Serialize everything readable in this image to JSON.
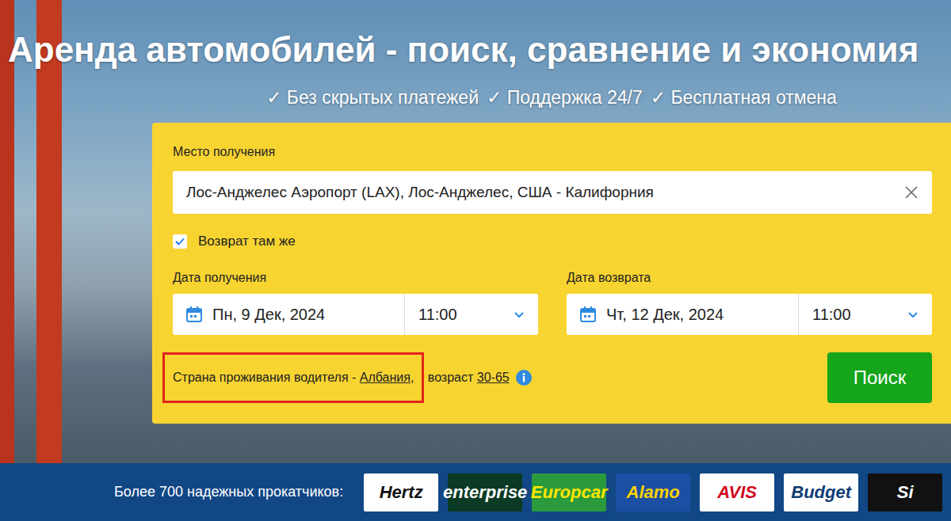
{
  "hero": {
    "title": "Аренда автомобилей - поиск, сравнение и экономия",
    "features": [
      "✓ Без скрытых платежей",
      "✓ Поддержка 24/7",
      "✓ Бесплатная отмена"
    ]
  },
  "form": {
    "pickup": {
      "label": "Место получения",
      "value": "Лос-Анджелес Аэропорт (LAX), Лос-Анджелес, США - Калифорния"
    },
    "return_same": {
      "label": "Возврат там же",
      "checked": true
    },
    "dates": [
      {
        "label": "Дата получения",
        "date": "Пн, 9 Дек, 2024",
        "time": "11:00"
      },
      {
        "label": "Дата возврата",
        "date": "Чт, 12 Дек, 2024",
        "time": "11:00"
      }
    ],
    "driver": {
      "prefix": "Страна проживания водителя - ",
      "country": "Албания",
      "comma": ",",
      "age_prefix": " возраст ",
      "age": "30-65",
      "highlighted": true
    },
    "search_button": "Поиск"
  },
  "partners": {
    "label": "Более 700 надежных прокатчиков:",
    "logos": [
      {
        "name": "Hertz",
        "color": "#111111",
        "background": "#ffffff"
      },
      {
        "name": "enterprise",
        "color": "#ffffff",
        "background": "#0b3b24"
      },
      {
        "name": "Europcar",
        "color": "#ffe600",
        "background": "#2a9a3c"
      },
      {
        "name": "Alamo",
        "color": "#ffd200",
        "background": "#1b4fa3"
      },
      {
        "name": "AVIS",
        "color": "#d2071c",
        "background": "#ffffff"
      },
      {
        "name": "Budget",
        "color": "#0f3c74",
        "background": "#ffffff"
      },
      {
        "name": "Si",
        "color": "#ffffff",
        "background": "#111111"
      }
    ]
  }
}
